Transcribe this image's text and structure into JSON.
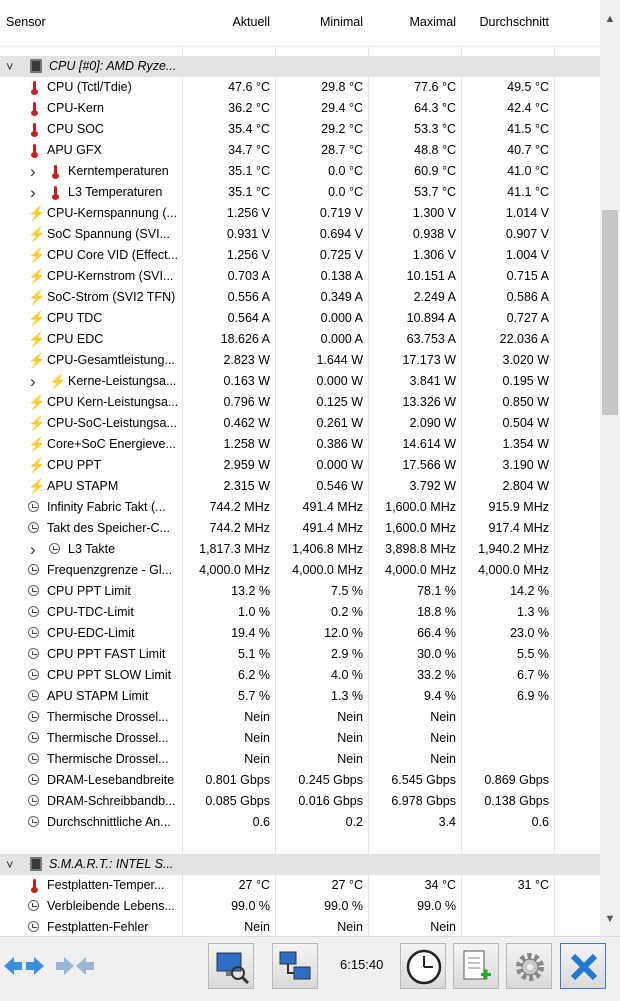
{
  "header": {
    "sensor": "Sensor",
    "current": "Aktuell",
    "min": "Minimal",
    "max": "Maximal",
    "avg": "Durchschnitt"
  },
  "rows": [
    {
      "type": "group",
      "icon": "chip-icon",
      "name": "CPU [#0]: AMD Ryze...",
      "values": [
        "",
        "",
        "",
        ""
      ]
    },
    {
      "type": "row",
      "icon": "thermometer-icon",
      "name": "CPU (Tctl/Tdie)",
      "values": [
        "47.6 °C",
        "29.8 °C",
        "77.6 °C",
        "49.5 °C"
      ]
    },
    {
      "type": "row",
      "icon": "thermometer-icon",
      "name": "CPU-Kern",
      "values": [
        "36.2 °C",
        "29.4 °C",
        "64.3 °C",
        "42.4 °C"
      ]
    },
    {
      "type": "row",
      "icon": "thermometer-icon",
      "name": "CPU SOC",
      "values": [
        "35.4 °C",
        "29.2 °C",
        "53.3 °C",
        "41.5 °C"
      ]
    },
    {
      "type": "row",
      "icon": "thermometer-icon",
      "name": "APU GFX",
      "values": [
        "34.7 °C",
        "28.7 °C",
        "48.8 °C",
        "40.7 °C"
      ]
    },
    {
      "type": "sub",
      "icon": "thermometer-icon",
      "name": "Kerntemperaturen",
      "values": [
        "35.1 °C",
        "0.0 °C",
        "60.9 °C",
        "41.0 °C"
      ]
    },
    {
      "type": "sub",
      "icon": "thermometer-icon",
      "name": "L3 Temperaturen",
      "values": [
        "35.1 °C",
        "0.0 °C",
        "53.7 °C",
        "41.1 °C"
      ]
    },
    {
      "type": "row",
      "icon": "lightning-icon",
      "name": "CPU-Kernspannung (...",
      "values": [
        "1.256 V",
        "0.719 V",
        "1.300 V",
        "1.014 V"
      ]
    },
    {
      "type": "row",
      "icon": "lightning-icon",
      "name": "SoC Spannung (SVI...",
      "values": [
        "0.931 V",
        "0.694 V",
        "0.938 V",
        "0.907 V"
      ]
    },
    {
      "type": "row",
      "icon": "lightning-icon",
      "name": "CPU Core VID (Effect...",
      "values": [
        "1.256 V",
        "0.725 V",
        "1.306 V",
        "1.004 V"
      ]
    },
    {
      "type": "row",
      "icon": "lightning-icon",
      "name": "CPU-Kernstrom (SVI...",
      "values": [
        "0.703 A",
        "0.138 A",
        "10.151 A",
        "0.715 A"
      ]
    },
    {
      "type": "row",
      "icon": "lightning-icon",
      "name": "SoC-Strom (SVI2 TFN)",
      "values": [
        "0.556 A",
        "0.349 A",
        "2.249 A",
        "0.586 A"
      ]
    },
    {
      "type": "row",
      "icon": "lightning-icon",
      "name": "CPU TDC",
      "values": [
        "0.564 A",
        "0.000 A",
        "10.894 A",
        "0.727 A"
      ]
    },
    {
      "type": "row",
      "icon": "lightning-icon",
      "name": "CPU EDC",
      "values": [
        "18.626 A",
        "0.000 A",
        "63.753 A",
        "22.036 A"
      ]
    },
    {
      "type": "row",
      "icon": "lightning-icon",
      "name": "CPU-Gesamtleistung...",
      "values": [
        "2.823 W",
        "1.644 W",
        "17.173 W",
        "3.020 W"
      ]
    },
    {
      "type": "sub",
      "icon": "lightning-icon",
      "name": "Kerne-Leistungsa...",
      "values": [
        "0.163 W",
        "0.000 W",
        "3.841 W",
        "0.195 W"
      ]
    },
    {
      "type": "row",
      "icon": "lightning-icon",
      "name": "CPU Kern-Leistungsa...",
      "values": [
        "0.796 W",
        "0.125 W",
        "13.326 W",
        "0.850 W"
      ]
    },
    {
      "type": "row",
      "icon": "lightning-icon",
      "name": "CPU-SoC-Leistungsa...",
      "values": [
        "0.462 W",
        "0.261 W",
        "2.090 W",
        "0.504 W"
      ]
    },
    {
      "type": "row",
      "icon": "lightning-icon",
      "name": "Core+SoC Energieve...",
      "values": [
        "1.258 W",
        "0.386 W",
        "14.614 W",
        "1.354 W"
      ]
    },
    {
      "type": "row",
      "icon": "lightning-icon",
      "name": "CPU PPT",
      "values": [
        "2.959 W",
        "0.000 W",
        "17.566 W",
        "3.190 W"
      ]
    },
    {
      "type": "row",
      "icon": "lightning-icon",
      "name": "APU STAPM",
      "values": [
        "2.315 W",
        "0.546 W",
        "3.792 W",
        "2.804 W"
      ]
    },
    {
      "type": "row",
      "icon": "clock-icon",
      "name": "Infinity Fabric Takt (...",
      "values": [
        "744.2 MHz",
        "491.4 MHz",
        "1,600.0 MHz",
        "915.9 MHz"
      ]
    },
    {
      "type": "row",
      "icon": "clock-icon",
      "name": "Takt des Speicher-C...",
      "values": [
        "744.2 MHz",
        "491.4 MHz",
        "1,600.0 MHz",
        "917.4 MHz"
      ]
    },
    {
      "type": "sub",
      "icon": "clock-icon",
      "name": "L3 Takte",
      "values": [
        "1,817.3 MHz",
        "1,406.8 MHz",
        "3,898.8 MHz",
        "1,940.2 MHz"
      ]
    },
    {
      "type": "row",
      "icon": "clock-icon",
      "name": "Frequenzgrenze - Gl...",
      "values": [
        "4,000.0 MHz",
        "4,000.0 MHz",
        "4,000.0 MHz",
        "4,000.0 MHz"
      ]
    },
    {
      "type": "row",
      "icon": "clock-icon",
      "name": "CPU PPT Limit",
      "values": [
        "13.2 %",
        "7.5 %",
        "78.1 %",
        "14.2 %"
      ]
    },
    {
      "type": "row",
      "icon": "clock-icon",
      "name": "CPU-TDC-Limit",
      "values": [
        "1.0 %",
        "0.2 %",
        "18.8 %",
        "1.3 %"
      ]
    },
    {
      "type": "row",
      "icon": "clock-icon",
      "name": "CPU-EDC-Limit",
      "values": [
        "19.4 %",
        "12.0 %",
        "66.4 %",
        "23.0 %"
      ]
    },
    {
      "type": "row",
      "icon": "clock-icon",
      "name": "CPU PPT FAST Limit",
      "values": [
        "5.1 %",
        "2.9 %",
        "30.0 %",
        "5.5 %"
      ]
    },
    {
      "type": "row",
      "icon": "clock-icon",
      "name": "CPU PPT SLOW Limit",
      "values": [
        "6.2 %",
        "4.0 %",
        "33.2 %",
        "6.7 %"
      ]
    },
    {
      "type": "row",
      "icon": "clock-icon",
      "name": "APU STAPM Limit",
      "values": [
        "5.7 %",
        "1.3 %",
        "9.4 %",
        "6.9 %"
      ]
    },
    {
      "type": "row",
      "icon": "clock-icon",
      "name": "Thermische Drossel...",
      "values": [
        "Nein",
        "Nein",
        "Nein",
        ""
      ]
    },
    {
      "type": "row",
      "icon": "clock-icon",
      "name": "Thermische Drossel...",
      "values": [
        "Nein",
        "Nein",
        "Nein",
        ""
      ]
    },
    {
      "type": "row",
      "icon": "clock-icon",
      "name": "Thermische Drossel...",
      "values": [
        "Nein",
        "Nein",
        "Nein",
        ""
      ]
    },
    {
      "type": "row",
      "icon": "clock-icon",
      "name": "DRAM-Lesebandbreite",
      "values": [
        "0.801 Gbps",
        "0.245 Gbps",
        "6.545 Gbps",
        "0.869 Gbps"
      ]
    },
    {
      "type": "row",
      "icon": "clock-icon",
      "name": "DRAM-Schreibbandb...",
      "values": [
        "0.085 Gbps",
        "0.016 Gbps",
        "6.978 Gbps",
        "0.138 Gbps"
      ]
    },
    {
      "type": "row",
      "icon": "clock-icon",
      "name": "Durchschnittliche An...",
      "values": [
        "0.6",
        "0.2",
        "3.4",
        "0.6"
      ]
    },
    {
      "type": "blank",
      "icon": "",
      "name": "",
      "values": [
        "",
        "",
        "",
        ""
      ]
    },
    {
      "type": "group",
      "icon": "chip-icon",
      "name": "S.M.A.R.T.: INTEL S...",
      "values": [
        "",
        "",
        "",
        ""
      ]
    },
    {
      "type": "row",
      "icon": "thermometer-icon",
      "name": "Festplatten-Temper...",
      "values": [
        "27 °C",
        "27 °C",
        "34 °C",
        "31 °C"
      ]
    },
    {
      "type": "row",
      "icon": "clock-icon",
      "name": "Verbleibende Lebens...",
      "values": [
        "99.0 %",
        "99.0 %",
        "99.0 %",
        ""
      ]
    },
    {
      "type": "row",
      "icon": "clock-icon",
      "name": "Festplatten-Fehler",
      "values": [
        "Nein",
        "Nein",
        "Nein",
        ""
      ]
    }
  ],
  "scrollbar": {
    "up_icon": "chevron-up-icon",
    "down_icon": "chevron-down-icon",
    "position": 0.35
  },
  "toolbar": {
    "time": "6:15:40"
  }
}
